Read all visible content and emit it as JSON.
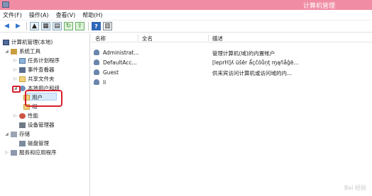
{
  "window": {
    "title": "计算机管理"
  },
  "menu": [
    "文件(F)",
    "操作(A)",
    "查看(V)",
    "帮助(H)"
  ],
  "toolbar": [
    "back-arrow-icon",
    "forward-arrow-icon",
    "folder-up-icon",
    "show-hide-tree-icon",
    "properties-icon",
    "refresh-icon",
    "export-icon",
    "help-icon",
    "panel-icon"
  ],
  "tree": {
    "root": "计算机管理(本地)",
    "system_tools": "系统工具",
    "task_scheduler": "任务计划程序",
    "event_viewer": "事件查看器",
    "shared_folders": "共享文件夹",
    "local_users_groups": "本地用户和组",
    "users": "用户",
    "groups": "组",
    "performance": "性能",
    "device_manager": "设备管理器",
    "storage": "存储",
    "disk_management": "磁盘管理",
    "services_apps": "服务和应用程序"
  },
  "list": {
    "columns": [
      "名称",
      "全名",
      "描述"
    ],
    "rows": [
      {
        "name": "Administrat...",
        "fullname": "",
        "desc": "管理计算机(域)的内置帐户"
      },
      {
        "name": "DefaultAcc...",
        "fullname": "",
        "desc": "[leprH]ʎ üšēr ǻçčõůņţ ɱąñåĝë..."
      },
      {
        "name": "Guest",
        "fullname": "",
        "desc": "供来宾访问计算机或访问域的内..."
      },
      {
        "name": "li",
        "fullname": "",
        "desc": ""
      }
    ]
  },
  "watermark": "Bai 经验"
}
